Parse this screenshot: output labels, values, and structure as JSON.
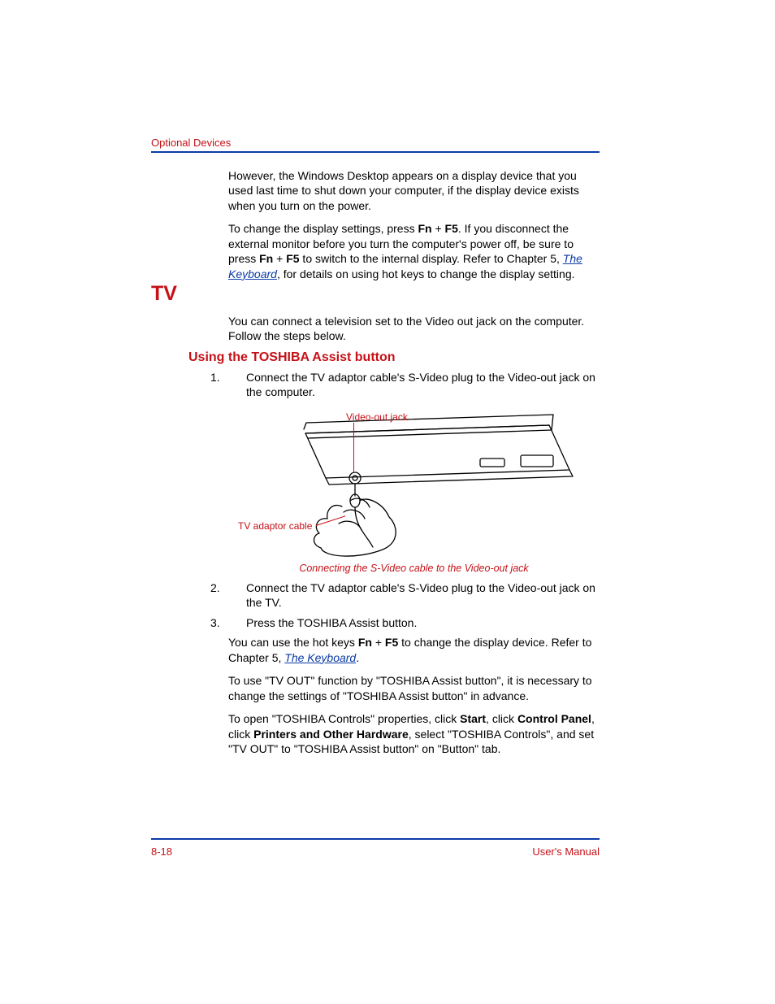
{
  "header": {
    "section": "Optional Devices"
  },
  "intro": {
    "p1": "However, the Windows Desktop appears on a display device that you used last time to shut down your computer, if the display device exists when you turn on the power.",
    "p2_a": "To change the display settings, press ",
    "p2_fn": "Fn",
    "p2_plus": " + ",
    "p2_f5": "F5",
    "p2_b": ". If you disconnect the external monitor before you turn the computer's power off, be sure to press ",
    "p2_fn2": "Fn",
    "p2_plus2": " + ",
    "p2_f52": "F5",
    "p2_c": " to switch to the internal display. Refer to Chapter 5, ",
    "p2_link": "The Keyboard",
    "p2_d": ", for details on using hot keys to change the display setting."
  },
  "heading1": "TV",
  "tv_intro": "You can connect a television set to the Video out jack on the computer. Follow the steps below.",
  "heading2": "Using the TOSHIBA Assist button",
  "steps": {
    "s1_num": "1.",
    "s1": "Connect the TV adaptor cable's S-Video plug to the Video-out jack on the computer.",
    "s2_num": "2.",
    "s2": "Connect the TV adaptor cable's S-Video plug to the Video-out jack on the TV.",
    "s3_num": "3.",
    "s3": "Press the TOSHIBA Assist button."
  },
  "figure": {
    "callout_top": "Video-out jack",
    "callout_left": "TV adaptor cable",
    "caption": "Connecting the S-Video cable to the Video-out jack"
  },
  "post": {
    "p1_a": "You can use the hot keys ",
    "p1_fn": "Fn",
    "p1_plus": " + ",
    "p1_f5": "F5",
    "p1_b": " to change the display device. Refer to Chapter 5, ",
    "p1_link": "The Keyboard",
    "p1_c": ".",
    "p2": "To use \"TV OUT\" function by \"TOSHIBA Assist button\", it is necessary to change the settings of \"TOSHIBA Assist button\" in advance.",
    "p3_a": "To open \"TOSHIBA Controls\" properties, click ",
    "p3_b1": "Start",
    "p3_b": ", click ",
    "p3_b2": "Control Panel",
    "p3_c": ", click ",
    "p3_b3": "Printers and Other Hardware",
    "p3_d": ", select \"TOSHIBA Controls\", and set \"TV OUT\" to \"TOSHIBA Assist button\" on \"Button\" tab."
  },
  "footer": {
    "left": "8-18",
    "right": "User's Manual"
  }
}
